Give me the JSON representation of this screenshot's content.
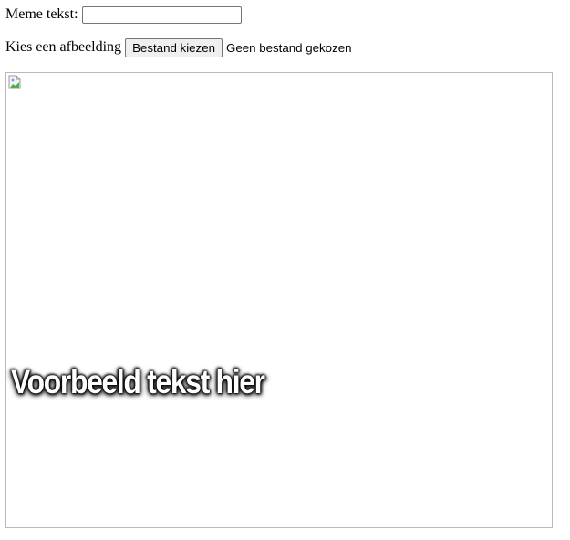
{
  "form": {
    "meme_text_label": "Meme tekst:",
    "meme_text_value": "",
    "image_label": "Kies een afbeelding",
    "file_button_label": "Bestand kiezen",
    "file_status": "Geen bestand gekozen"
  },
  "canvas": {
    "overlay_text": "Voorbeeld tekst hier",
    "image_icon": "broken-image-icon"
  }
}
